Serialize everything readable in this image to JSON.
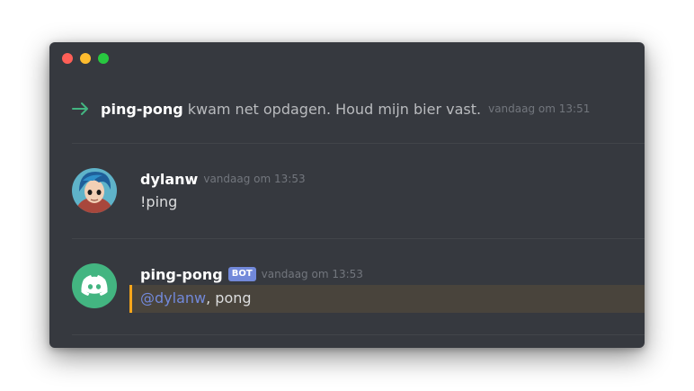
{
  "window_controls": [
    "close",
    "minimize",
    "maximize"
  ],
  "system_message": {
    "icon": "join-arrow-icon",
    "username": "ping-pong",
    "text": "kwam net opdagen. Houd mijn bier vast.",
    "timestamp": "vandaag om 13:51",
    "accent_color": "#43b581"
  },
  "messages": [
    {
      "username": "dylanw",
      "timestamp": "vandaag om 13:53",
      "content": "!ping",
      "avatar": "user-avatar"
    },
    {
      "username": "ping-pong",
      "badge": "BOT",
      "timestamp": "vandaag om 13:53",
      "mention": "@dylanw",
      "content": ", pong",
      "avatar": "discord-logo",
      "avatar_color": "#43b581",
      "mention_highlight_color": "#faa61a"
    }
  ]
}
